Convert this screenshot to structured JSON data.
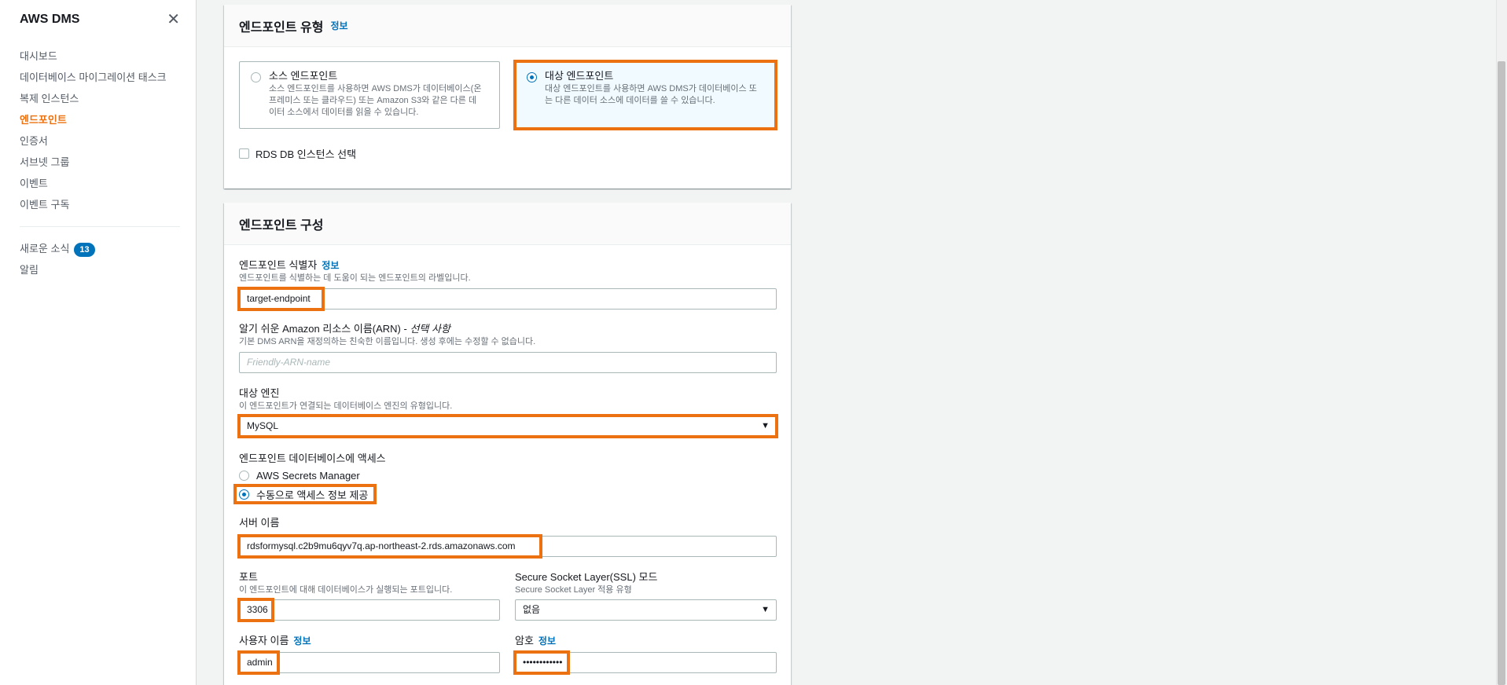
{
  "sidebar": {
    "title": "AWS DMS",
    "close_icon": "close-icon",
    "items": [
      {
        "label": "대시보드"
      },
      {
        "label": "데이터베이스 마이그레이션 태스크"
      },
      {
        "label": "복제 인스턴스"
      },
      {
        "label": "엔드포인트",
        "active": true
      },
      {
        "label": "인증서"
      },
      {
        "label": "서브넷 그룹"
      },
      {
        "label": "이벤트"
      },
      {
        "label": "이벤트 구독"
      }
    ],
    "news": {
      "label": "새로운 소식",
      "badge": "13"
    },
    "alerts": {
      "label": "알림"
    }
  },
  "endpoint_type": {
    "title": "엔드포인트 유형",
    "info": "정보",
    "source": {
      "title": "소스 엔드포인트",
      "desc": [
        "소스 엔드포인트를 사용하면 AWS DMS가 데이터베이스(온",
        "프레미스 또는 클라우드) 또는 Amazon S3와 같은 다른 데",
        "이터 소스에서 데이터를 읽을 수 있습니다."
      ]
    },
    "target": {
      "title": "대상 엔드포인트",
      "desc": [
        "대상 엔드포인트를 사용하면 AWS DMS가 데이터베이스 또",
        "는 다른 데이터 소스에 데이터를 쓸 수 있습니다."
      ]
    },
    "rds_checkbox": "RDS DB 인스턴스 선택"
  },
  "endpoint_config": {
    "title": "엔드포인트 구성",
    "identifier": {
      "label": "엔드포인트 식별자",
      "info": "정보",
      "desc": "엔드포인트를 식별하는 데 도움이 되는 엔드포인트의 라벨입니다.",
      "value": "target-endpoint"
    },
    "arn": {
      "label": "알기 쉬운 Amazon 리소스 이름(ARN) - ",
      "optional": "선택 사항",
      "desc": "기본 DMS ARN을 재정의하는 친숙한 이름입니다. 생성 후에는 수정할 수 없습니다.",
      "placeholder": "Friendly-ARN-name"
    },
    "engine": {
      "label": "대상 엔진",
      "desc": "이 엔드포인트가 연결되는 데이터베이스 엔진의 유형입니다.",
      "value": "MySQL"
    },
    "access": {
      "label": "엔드포인트 데이터베이스에 액세스",
      "option_secrets": "AWS Secrets Manager",
      "option_manual": "수동으로 액세스 정보 제공",
      "selected": "manual"
    },
    "server": {
      "label": "서버 이름",
      "value": "rdsformysql.c2b9mu6qyv7q.ap-northeast-2.rds.amazonaws.com"
    },
    "port": {
      "label": "포트",
      "desc": "이 엔드포인트에 대해 데이터베이스가 실행되는 포트입니다.",
      "value": "3306"
    },
    "ssl": {
      "label": "Secure Socket Layer(SSL) 모드",
      "desc": "Secure Socket Layer 적용 유형",
      "value": "없음"
    },
    "username": {
      "label": "사용자 이름",
      "info": "정보",
      "value": "admin"
    },
    "password": {
      "label": "암호",
      "info": "정보",
      "value": "••••••••••••"
    }
  },
  "colors": {
    "highlight": "#ec7211",
    "link": "#0073bb",
    "active_nav": "#ec7211"
  }
}
